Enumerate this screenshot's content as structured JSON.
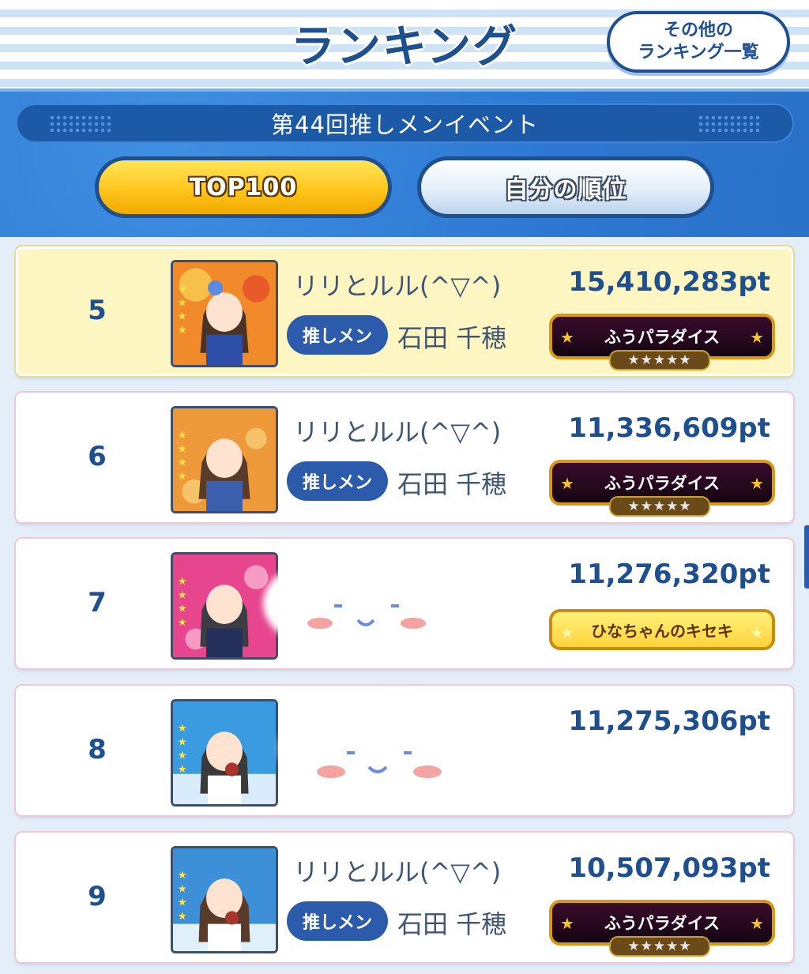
{
  "header": {
    "title": "ランキング",
    "other_button": "その他の\nランキング一覧"
  },
  "event": {
    "name": "第44回推しメンイベント"
  },
  "tabs": {
    "top100": "TOP100",
    "my_rank": "自分の順位"
  },
  "rows": [
    {
      "rank": "5",
      "name": "リリとルル(^▽^)",
      "badge": "推しメン",
      "member": "石田 千穂",
      "points": "15,410,283pt",
      "title": "ふうパラダイス",
      "title_stars": "★★★★★"
    },
    {
      "rank": "6",
      "name": "リリとルル(^▽^)",
      "badge": "推しメン",
      "member": "石田 千穂",
      "points": "11,336,609pt",
      "title": "ふうパラダイス",
      "title_stars": "★★★★★"
    },
    {
      "rank": "7",
      "name": "",
      "badge": "",
      "member": "",
      "points": "11,276,320pt",
      "title": "ひなちゃんのキセキ",
      "title_stars": ""
    },
    {
      "rank": "8",
      "name": "",
      "badge": "",
      "member": "",
      "points": "11,275,306pt",
      "title": "",
      "title_stars": ""
    },
    {
      "rank": "9",
      "name": "リリとルル(^▽^)",
      "badge": "推しメン",
      "member": "石田 千穂",
      "points": "10,507,093pt",
      "title": "ふうパラダイス",
      "title_stars": "★★★★★"
    }
  ],
  "colors": {
    "primary": "#1e4f8e",
    "highlight_row": "#fdf6c2",
    "gold": "#ffc61c"
  }
}
